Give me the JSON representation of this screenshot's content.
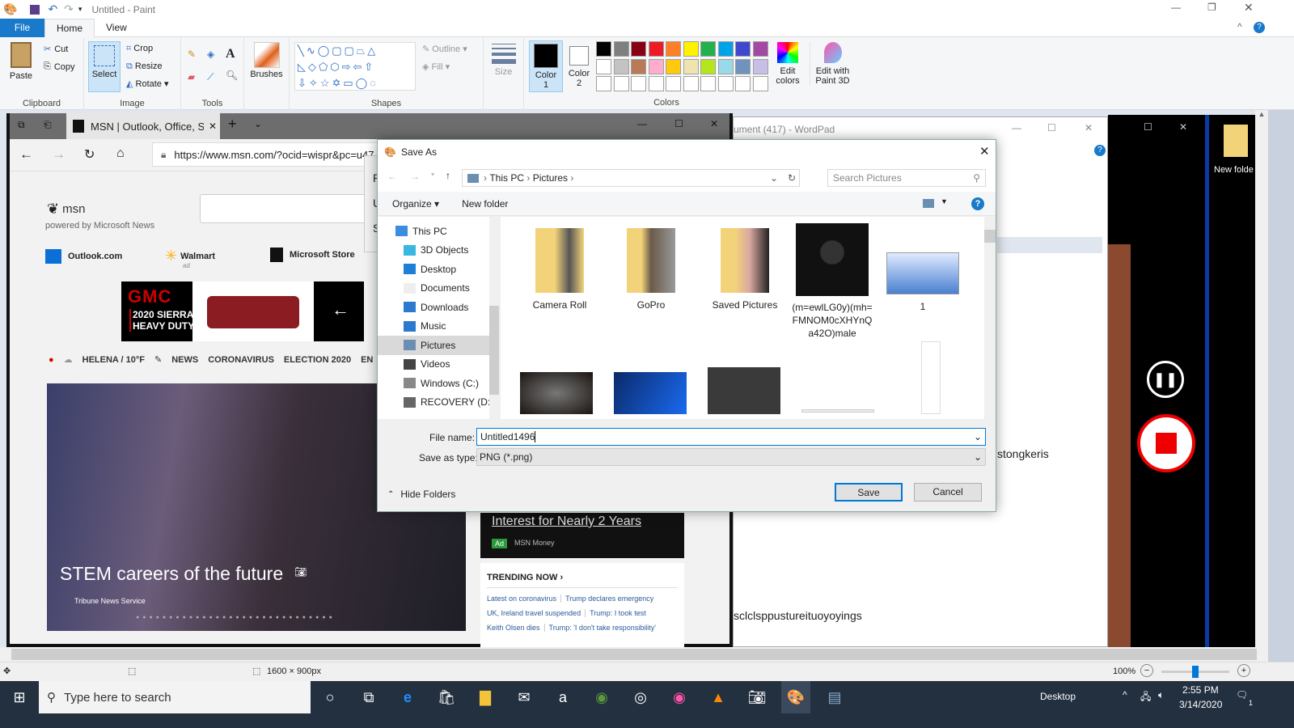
{
  "paint": {
    "title": "Untitled - Paint",
    "tabs": [
      "File",
      "Home",
      "View"
    ],
    "clipboard": {
      "paste": "Paste",
      "cut": "Cut",
      "copy": "Copy",
      "label": "Clipboard"
    },
    "image": {
      "select": "Select",
      "crop": "Crop",
      "resize": "Resize",
      "rotate": "Rotate",
      "label": "Image"
    },
    "tools_label": "Tools",
    "brushes": "Brushes",
    "shapes": {
      "outline": "Outline",
      "fill": "Fill",
      "label": "Shapes"
    },
    "size": "Size",
    "color1": "Color 1",
    "color2": "Color 2",
    "colors_label": "Colors",
    "edit_colors": "Edit colors",
    "paint3d": "Edit with Paint 3D",
    "palette": [
      "#000000",
      "#7f7f7f",
      "#880015",
      "#ed1c24",
      "#ff7f27",
      "#fff200",
      "#22b14c",
      "#00a2e8",
      "#3f48cc",
      "#a349a4",
      "#ffffff",
      "#c3c3c3",
      "#b97a57",
      "#ffaec9",
      "#ffc90e",
      "#efe4b0",
      "#b5e61d",
      "#99d9ea",
      "#7092be",
      "#c8bfe7"
    ],
    "status": {
      "dimensions": "1600 × 900px",
      "zoom": "100%",
      "zoom_level": 100
    }
  },
  "edge": {
    "tab_title": "MSN | Outlook, Office, S",
    "url": "https://www.msn.com/?ocid=wispr&pc=u47",
    "msn_logo": "msn",
    "powered": "powered by Microsoft News",
    "links": [
      {
        "label": "Outlook.com"
      },
      {
        "label": "Walmart",
        "sub": "ad"
      },
      {
        "label": "Microsoft Store"
      }
    ],
    "ad": {
      "brand": "GMC",
      "line1": "2020 SIERRA",
      "line2": "HEAVY DUTY"
    },
    "nav": {
      "weather": "HELENA / 10°F",
      "items": [
        "NEWS",
        "CORONAVIRUS",
        "ELECTION 2020",
        "EN"
      ]
    },
    "hero": {
      "title": "STEM careers of the future",
      "source": "Tribune News Service"
    },
    "money_ad": {
      "headline": "Interest for Nearly 2 Years",
      "badge": "Ad",
      "source": "MSN Money"
    },
    "trending": {
      "title": "TRENDING NOW ›",
      "rows": [
        [
          "Latest on coronavirus",
          "Trump declares emergency"
        ],
        [
          "UK, Ireland travel suspended",
          "Trump: I took test"
        ],
        [
          "Keith Olsen dies",
          "Trump: 'I don't take responsibility'"
        ]
      ]
    },
    "side_letters": [
      "P",
      "U",
      "S"
    ]
  },
  "wordpad": {
    "title": "ument (417) - WordPad",
    "text1": "stongkeris",
    "text2": "sclclsppustureituoyoyings"
  },
  "desktop": {
    "folder": "New folde"
  },
  "dialog": {
    "title": "Save As",
    "breadcrumb": [
      "This PC",
      "Pictures"
    ],
    "search_placeholder": "Search Pictures",
    "organize": "Organize ▾",
    "new_folder": "New folder",
    "nav": [
      "This PC",
      "3D Objects",
      "Desktop",
      "Documents",
      "Downloads",
      "Music",
      "Pictures",
      "Videos",
      "Windows (C:)",
      "RECOVERY (D:)"
    ],
    "selected_nav": "Pictures",
    "items": [
      "Camera Roll",
      "GoPro",
      "Saved Pictures",
      "(m=ewlLG0y)(mh=FMNOM0cXHYnQa42O)male",
      "1"
    ],
    "file_name_label": "File name:",
    "file_name": "Untitled1496",
    "type_label": "Save as type:",
    "type": "PNG (*.png)",
    "hide_folders": "Hide Folders",
    "save": "Save",
    "cancel": "Cancel"
  },
  "taskbar": {
    "search": "Type here to search",
    "desktop": "Desktop",
    "time": "2:55 PM",
    "date": "3/14/2020",
    "notif": "1"
  }
}
